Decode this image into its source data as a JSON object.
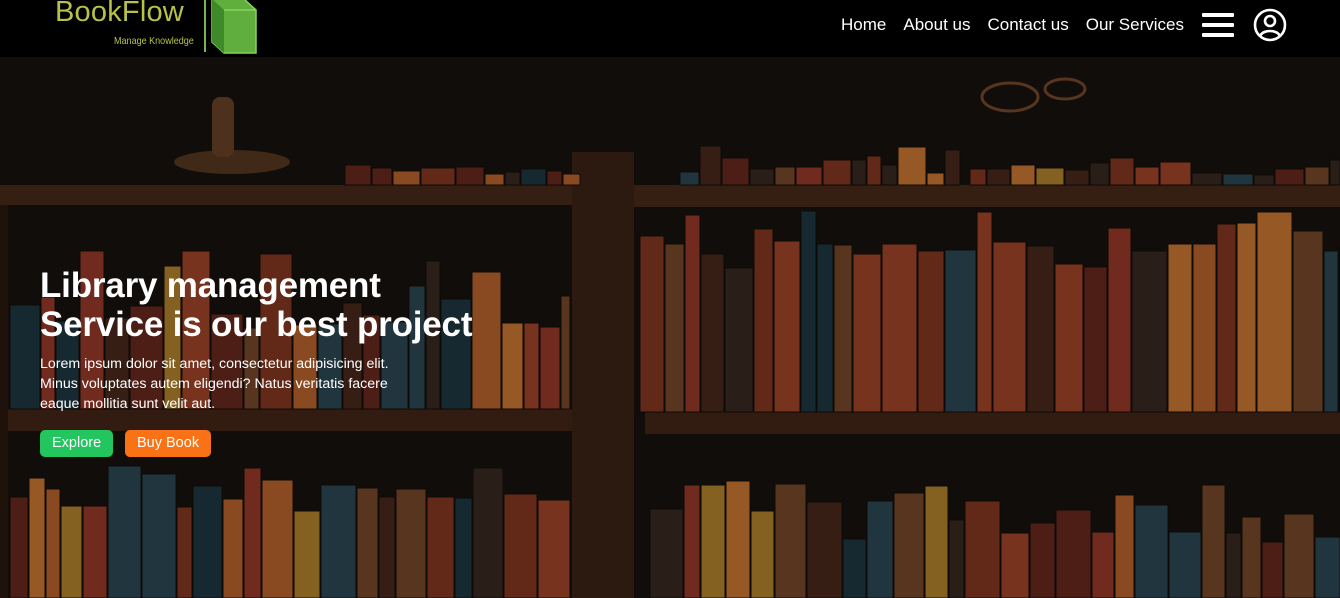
{
  "brand": {
    "name": "BookFlow",
    "tagline": "Manage Knowledge",
    "color": "#b7c247",
    "book_color": "#5fae3e"
  },
  "nav": {
    "links": [
      "Home",
      "About us",
      "Contact us",
      "Our Services"
    ],
    "menu_icon": "hamburger-menu-icon",
    "account_icon": "user-circle-icon"
  },
  "hero": {
    "headline_line1": "Library management",
    "headline_line2": "Service is our best project",
    "description": "Lorem ipsum dolor sit amet, consectetur adipisicing elit. Minus voluptates autem eligendi? Natus veritatis facere eaque mollitia sunt velit aut.",
    "buttons": {
      "explore": "Explore",
      "buy": "Buy Book"
    },
    "background": "bookshelf-photo"
  },
  "colors": {
    "navbar_bg": "#000000",
    "explore_btn": "#22c55e",
    "buy_btn": "#f97316",
    "text": "#ffffff"
  }
}
